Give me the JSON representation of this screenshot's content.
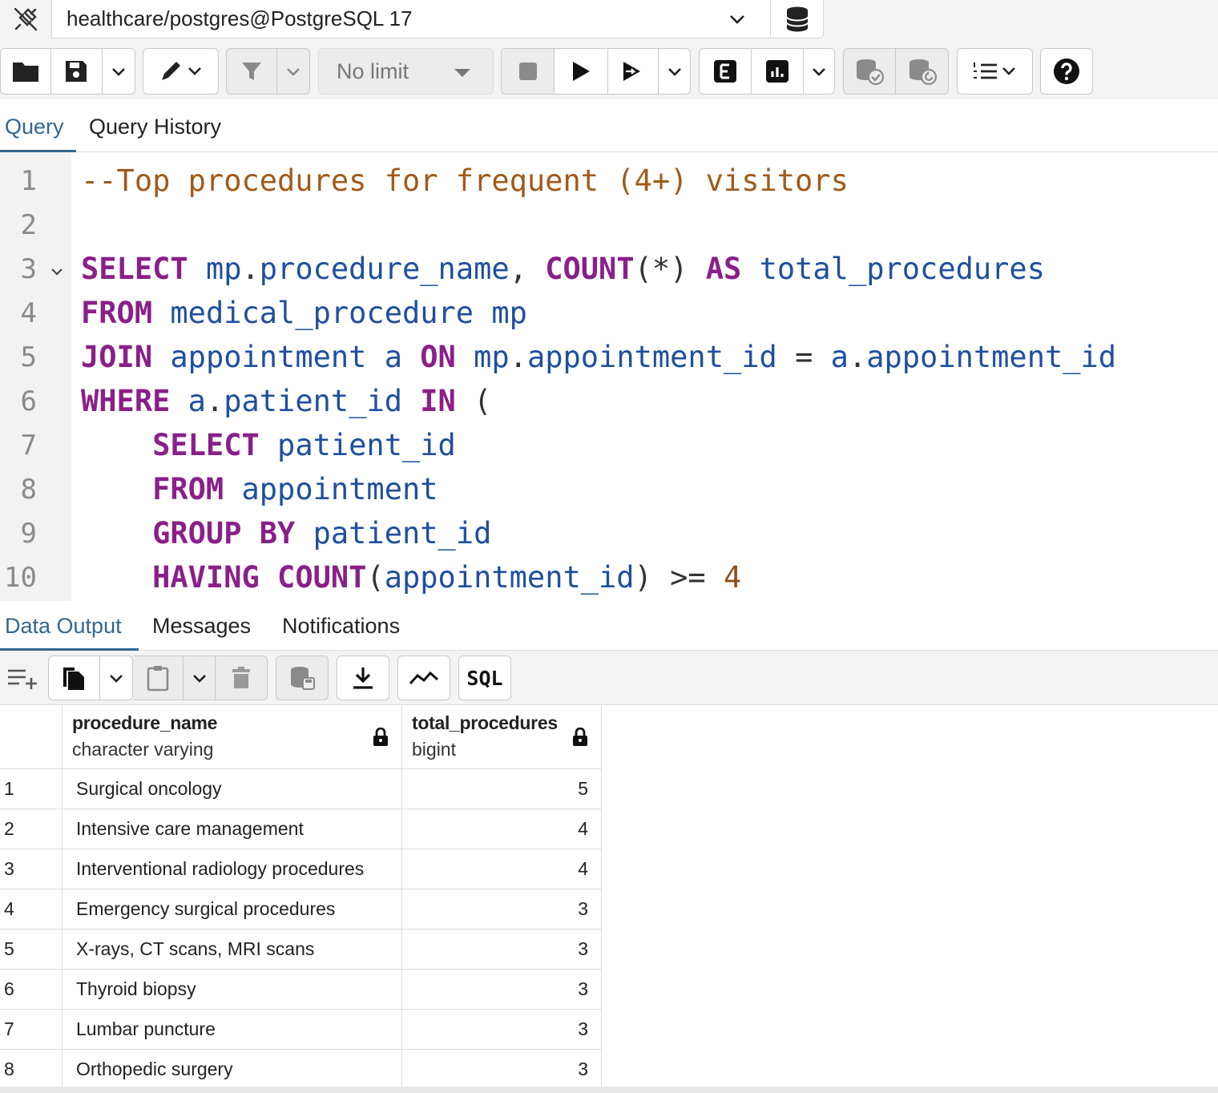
{
  "connection": {
    "label": "healthcare/postgres@PostgreSQL 17"
  },
  "toolbar": {
    "limit_label": "No limit"
  },
  "editor_tabs": [
    {
      "label": "Query",
      "active": true
    },
    {
      "label": "Query History",
      "active": false
    }
  ],
  "editor": {
    "line_numbers": [
      "1",
      "2",
      "3",
      "4",
      "5",
      "6",
      "7",
      "8",
      "9",
      "10"
    ],
    "lines": [
      [
        {
          "t": "comment",
          "v": "--Top procedures for frequent (4+) visitors"
        }
      ],
      [],
      [
        {
          "t": "kw",
          "v": "SELECT"
        },
        {
          "t": "sp",
          "v": " "
        },
        {
          "t": "id",
          "v": "mp"
        },
        {
          "t": "op",
          "v": "."
        },
        {
          "t": "id",
          "v": "procedure_name"
        },
        {
          "t": "op",
          "v": ", "
        },
        {
          "t": "kw",
          "v": "COUNT"
        },
        {
          "t": "op",
          "v": "(*) "
        },
        {
          "t": "kw",
          "v": "AS"
        },
        {
          "t": "sp",
          "v": " "
        },
        {
          "t": "id",
          "v": "total_procedures"
        }
      ],
      [
        {
          "t": "kw",
          "v": "FROM"
        },
        {
          "t": "sp",
          "v": " "
        },
        {
          "t": "id",
          "v": "medical_procedure mp"
        }
      ],
      [
        {
          "t": "kw",
          "v": "JOIN"
        },
        {
          "t": "sp",
          "v": " "
        },
        {
          "t": "id",
          "v": "appointment a"
        },
        {
          "t": "sp",
          "v": " "
        },
        {
          "t": "kw",
          "v": "ON"
        },
        {
          "t": "sp",
          "v": " "
        },
        {
          "t": "id",
          "v": "mp"
        },
        {
          "t": "op",
          "v": "."
        },
        {
          "t": "id",
          "v": "appointment_id"
        },
        {
          "t": "op",
          "v": " = "
        },
        {
          "t": "id",
          "v": "a"
        },
        {
          "t": "op",
          "v": "."
        },
        {
          "t": "id",
          "v": "appointment_id"
        }
      ],
      [
        {
          "t": "kw",
          "v": "WHERE"
        },
        {
          "t": "sp",
          "v": " "
        },
        {
          "t": "id",
          "v": "a"
        },
        {
          "t": "op",
          "v": "."
        },
        {
          "t": "id",
          "v": "patient_id"
        },
        {
          "t": "sp",
          "v": " "
        },
        {
          "t": "kw",
          "v": "IN"
        },
        {
          "t": "op",
          "v": " ("
        }
      ],
      [
        {
          "t": "sp",
          "v": "    "
        },
        {
          "t": "kw",
          "v": "SELECT"
        },
        {
          "t": "sp",
          "v": " "
        },
        {
          "t": "id",
          "v": "patient_id"
        }
      ],
      [
        {
          "t": "sp",
          "v": "    "
        },
        {
          "t": "kw",
          "v": "FROM"
        },
        {
          "t": "sp",
          "v": " "
        },
        {
          "t": "id",
          "v": "appointment"
        }
      ],
      [
        {
          "t": "sp",
          "v": "    "
        },
        {
          "t": "kw",
          "v": "GROUP BY"
        },
        {
          "t": "sp",
          "v": " "
        },
        {
          "t": "id",
          "v": "patient_id"
        }
      ],
      [
        {
          "t": "sp",
          "v": "    "
        },
        {
          "t": "kw",
          "v": "HAVING"
        },
        {
          "t": "sp",
          "v": " "
        },
        {
          "t": "kw",
          "v": "COUNT"
        },
        {
          "t": "op",
          "v": "("
        },
        {
          "t": "id",
          "v": "appointment_id"
        },
        {
          "t": "op",
          "v": ") >= "
        },
        {
          "t": "num",
          "v": "4"
        }
      ]
    ]
  },
  "output_tabs": [
    {
      "label": "Data Output",
      "active": true
    },
    {
      "label": "Messages",
      "active": false
    },
    {
      "label": "Notifications",
      "active": false
    }
  ],
  "output_toolbar": {
    "sql_label": "SQL"
  },
  "grid": {
    "columns": [
      {
        "name": "procedure_name",
        "type": "character varying"
      },
      {
        "name": "total_procedures",
        "type": "bigint"
      }
    ],
    "rows": [
      {
        "n": "1",
        "procedure_name": "Surgical oncology",
        "total_procedures": "5"
      },
      {
        "n": "2",
        "procedure_name": "Intensive care management",
        "total_procedures": "4"
      },
      {
        "n": "3",
        "procedure_name": "Interventional radiology procedures",
        "total_procedures": "4"
      },
      {
        "n": "4",
        "procedure_name": "Emergency surgical procedures",
        "total_procedures": "3"
      },
      {
        "n": "5",
        "procedure_name": "X-rays, CT scans, MRI scans",
        "total_procedures": "3"
      },
      {
        "n": "6",
        "procedure_name": "Thyroid biopsy",
        "total_procedures": "3"
      },
      {
        "n": "7",
        "procedure_name": "Lumbar puncture",
        "total_procedures": "3"
      },
      {
        "n": "8",
        "procedure_name": "Orthopedic surgery",
        "total_procedures": "3"
      }
    ]
  },
  "colors": {
    "accent": "#326690",
    "keyword": "#8a1f8a",
    "identifier": "#1f4f9f",
    "comment": "#a05a1a"
  }
}
